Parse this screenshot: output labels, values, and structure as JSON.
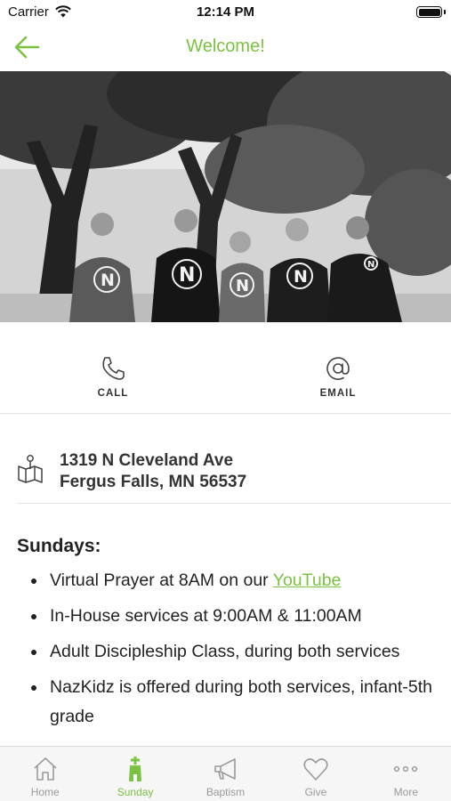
{
  "status_bar": {
    "carrier": "Carrier",
    "time": "12:14 PM"
  },
  "nav": {
    "title": "Welcome!",
    "back_icon": "arrow-left-icon"
  },
  "hero": {
    "description_icon": "group-photo"
  },
  "actions": [
    {
      "label": "CALL",
      "icon": "phone-icon"
    },
    {
      "label": "EMAIL",
      "icon": "at-sign-icon"
    }
  ],
  "address": {
    "line1": "1319 N Cleveland Ave",
    "line2": "Fergus Falls, MN 56537",
    "icon": "map-pin-icon"
  },
  "content": {
    "heading": "Sundays:",
    "items": [
      {
        "prefix": "Virtual Prayer at 8AM on our ",
        "link": "YouTube"
      },
      {
        "text": "In-House services at 9:00AM & 11:00AM"
      },
      {
        "text": "Adult Discipleship Class, during both services"
      },
      {
        "text": "NazKidz is offered during both services, infant-5th grade"
      }
    ]
  },
  "tabs": [
    {
      "label": "Home",
      "icon": "home-icon",
      "active": false
    },
    {
      "label": "Sunday",
      "icon": "church-icon",
      "active": true
    },
    {
      "label": "Baptism",
      "icon": "megaphone-icon",
      "active": false
    },
    {
      "label": "Give",
      "icon": "heart-icon",
      "active": false
    },
    {
      "label": "More",
      "icon": "more-dots-icon",
      "active": false
    }
  ],
  "colors": {
    "accent": "#7cc242",
    "inactive_tab": "#9a9a9a",
    "text": "#222222"
  }
}
